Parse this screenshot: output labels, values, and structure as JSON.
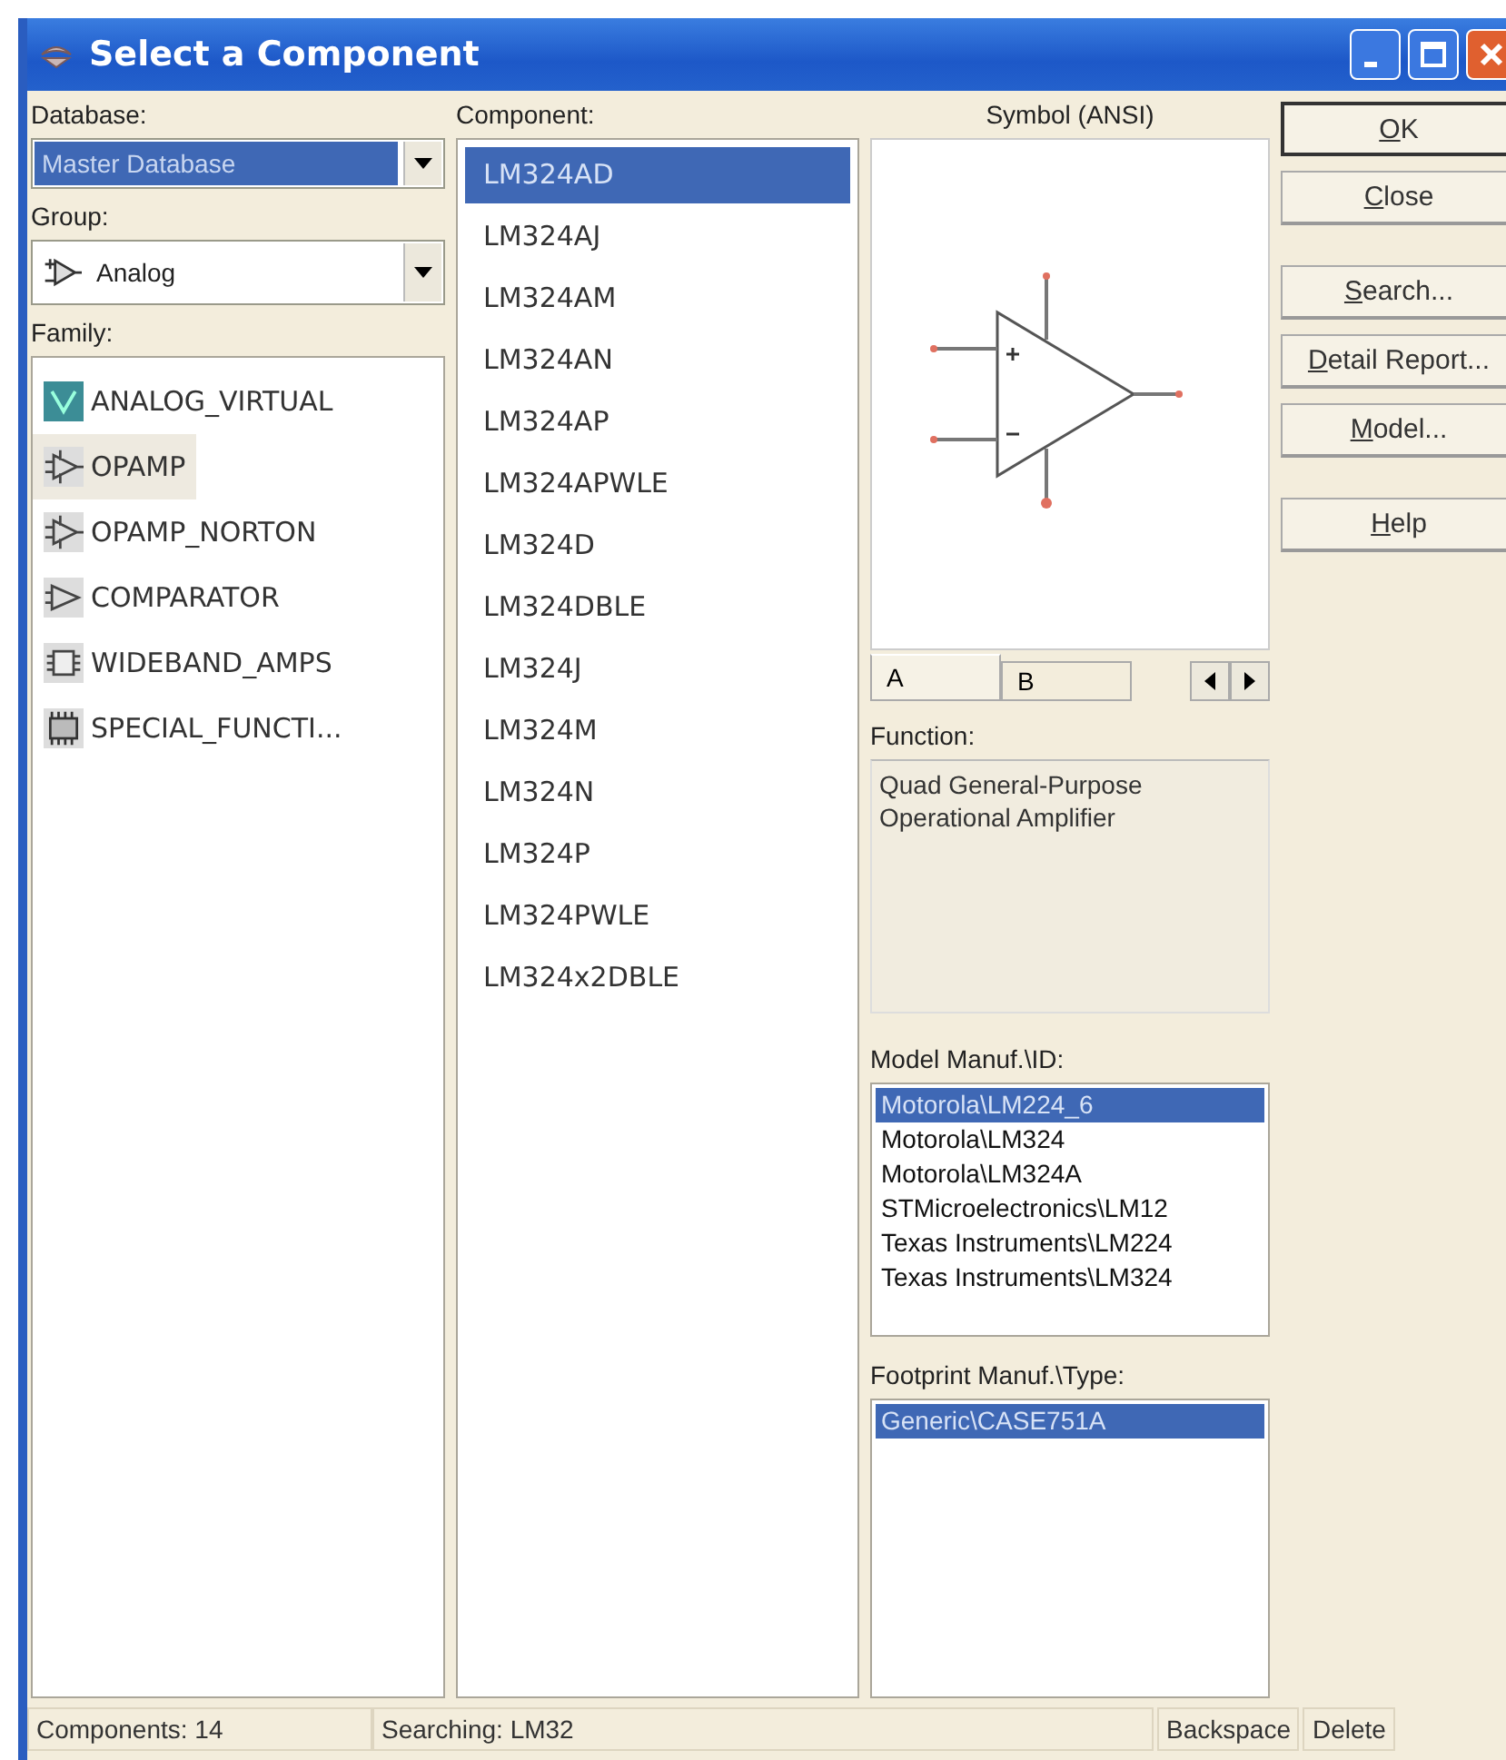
{
  "window": {
    "title": "Select a Component"
  },
  "database": {
    "label": "Database:",
    "value": "Master Database"
  },
  "group": {
    "label": "Group:",
    "value": "Analog",
    "kind": "analog"
  },
  "family": {
    "label": "Family:",
    "items": [
      {
        "label": "ANALOG_VIRTUAL",
        "kind": "virtual",
        "selected": false
      },
      {
        "label": "OPAMP",
        "kind": "opamp",
        "selected": true
      },
      {
        "label": "OPAMP_NORTON",
        "kind": "opamp",
        "selected": false
      },
      {
        "label": "COMPARATOR",
        "kind": "comparator",
        "selected": false
      },
      {
        "label": "WIDEBAND_AMPS",
        "kind": "chip",
        "selected": false
      },
      {
        "label": "SPECIAL_FUNCTI...",
        "kind": "special",
        "selected": false
      }
    ]
  },
  "component": {
    "label": "Component:",
    "items": [
      {
        "label": "LM324AD",
        "selected": true
      },
      {
        "label": "LM324AJ",
        "selected": false
      },
      {
        "label": "LM324AM",
        "selected": false
      },
      {
        "label": "LM324AN",
        "selected": false
      },
      {
        "label": "LM324AP",
        "selected": false
      },
      {
        "label": "LM324APWLE",
        "selected": false
      },
      {
        "label": "LM324D",
        "selected": false
      },
      {
        "label": "LM324DBLE",
        "selected": false
      },
      {
        "label": "LM324J",
        "selected": false
      },
      {
        "label": "LM324M",
        "selected": false
      },
      {
        "label": "LM324N",
        "selected": false
      },
      {
        "label": "LM324P",
        "selected": false
      },
      {
        "label": "LM324PWLE",
        "selected": false
      },
      {
        "label": "LM324x2DBLE",
        "selected": false
      }
    ]
  },
  "symbol": {
    "label": "Symbol (ANSI)",
    "tabs": [
      {
        "label": "A",
        "selected": true
      },
      {
        "label": "B",
        "selected": false
      }
    ]
  },
  "function": {
    "label": "Function:",
    "text": "Quad General-Purpose Operational Amplifier"
  },
  "model": {
    "label": "Model Manuf.\\ID:",
    "items": [
      {
        "label": "Motorola\\LM224_6",
        "selected": true
      },
      {
        "label": "Motorola\\LM324",
        "selected": false
      },
      {
        "label": "Motorola\\LM324A",
        "selected": false
      },
      {
        "label": "STMicroelectronics\\LM12",
        "selected": false
      },
      {
        "label": "Texas Instruments\\LM224",
        "selected": false
      },
      {
        "label": "Texas Instruments\\LM324",
        "selected": false
      }
    ]
  },
  "footprint": {
    "label": "Footprint Manuf.\\Type:",
    "items": [
      {
        "label": "Generic\\CASE751A",
        "selected": true
      }
    ]
  },
  "buttons": [
    {
      "label": "OK",
      "default": true
    },
    {
      "label": "Close",
      "default": false
    },
    {
      "label": "Search...",
      "default": false
    },
    {
      "label": "Detail Report...",
      "default": false
    },
    {
      "label": "Model...",
      "default": false
    },
    {
      "label": "Help",
      "default": false
    }
  ],
  "status_bar": {
    "count": "Components: 14",
    "search": "Searching: LM32",
    "keys": [
      "Backspace",
      "Delete"
    ]
  }
}
